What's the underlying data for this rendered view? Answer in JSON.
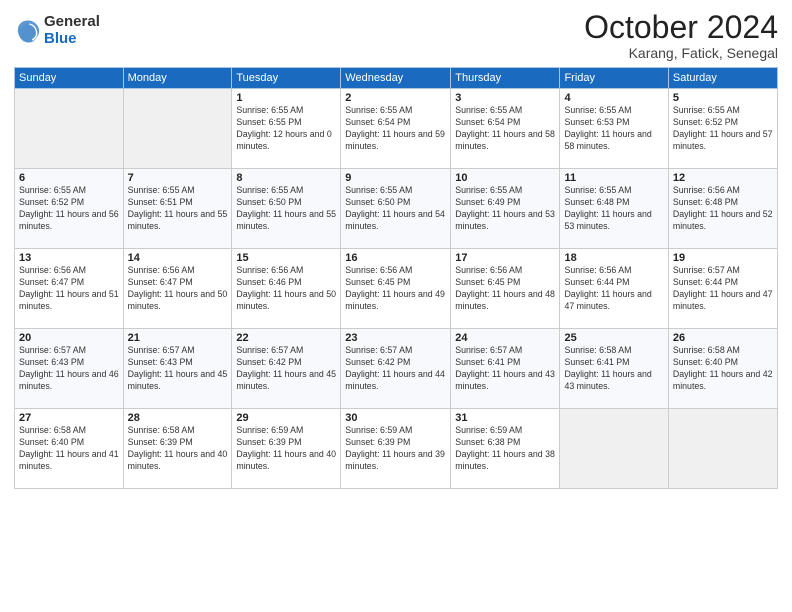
{
  "logo": {
    "general": "General",
    "blue": "Blue"
  },
  "title": "October 2024",
  "location": "Karang, Fatick, Senegal",
  "weekdays": [
    "Sunday",
    "Monday",
    "Tuesday",
    "Wednesday",
    "Thursday",
    "Friday",
    "Saturday"
  ],
  "weeks": [
    [
      {
        "day": "",
        "empty": true
      },
      {
        "day": "",
        "empty": true
      },
      {
        "day": "1",
        "sunrise": "Sunrise: 6:55 AM",
        "sunset": "Sunset: 6:55 PM",
        "daylight": "Daylight: 12 hours and 0 minutes."
      },
      {
        "day": "2",
        "sunrise": "Sunrise: 6:55 AM",
        "sunset": "Sunset: 6:54 PM",
        "daylight": "Daylight: 11 hours and 59 minutes."
      },
      {
        "day": "3",
        "sunrise": "Sunrise: 6:55 AM",
        "sunset": "Sunset: 6:54 PM",
        "daylight": "Daylight: 11 hours and 58 minutes."
      },
      {
        "day": "4",
        "sunrise": "Sunrise: 6:55 AM",
        "sunset": "Sunset: 6:53 PM",
        "daylight": "Daylight: 11 hours and 58 minutes."
      },
      {
        "day": "5",
        "sunrise": "Sunrise: 6:55 AM",
        "sunset": "Sunset: 6:52 PM",
        "daylight": "Daylight: 11 hours and 57 minutes."
      }
    ],
    [
      {
        "day": "6",
        "sunrise": "Sunrise: 6:55 AM",
        "sunset": "Sunset: 6:52 PM",
        "daylight": "Daylight: 11 hours and 56 minutes."
      },
      {
        "day": "7",
        "sunrise": "Sunrise: 6:55 AM",
        "sunset": "Sunset: 6:51 PM",
        "daylight": "Daylight: 11 hours and 55 minutes."
      },
      {
        "day": "8",
        "sunrise": "Sunrise: 6:55 AM",
        "sunset": "Sunset: 6:50 PM",
        "daylight": "Daylight: 11 hours and 55 minutes."
      },
      {
        "day": "9",
        "sunrise": "Sunrise: 6:55 AM",
        "sunset": "Sunset: 6:50 PM",
        "daylight": "Daylight: 11 hours and 54 minutes."
      },
      {
        "day": "10",
        "sunrise": "Sunrise: 6:55 AM",
        "sunset": "Sunset: 6:49 PM",
        "daylight": "Daylight: 11 hours and 53 minutes."
      },
      {
        "day": "11",
        "sunrise": "Sunrise: 6:55 AM",
        "sunset": "Sunset: 6:48 PM",
        "daylight": "Daylight: 11 hours and 53 minutes."
      },
      {
        "day": "12",
        "sunrise": "Sunrise: 6:56 AM",
        "sunset": "Sunset: 6:48 PM",
        "daylight": "Daylight: 11 hours and 52 minutes."
      }
    ],
    [
      {
        "day": "13",
        "sunrise": "Sunrise: 6:56 AM",
        "sunset": "Sunset: 6:47 PM",
        "daylight": "Daylight: 11 hours and 51 minutes."
      },
      {
        "day": "14",
        "sunrise": "Sunrise: 6:56 AM",
        "sunset": "Sunset: 6:47 PM",
        "daylight": "Daylight: 11 hours and 50 minutes."
      },
      {
        "day": "15",
        "sunrise": "Sunrise: 6:56 AM",
        "sunset": "Sunset: 6:46 PM",
        "daylight": "Daylight: 11 hours and 50 minutes."
      },
      {
        "day": "16",
        "sunrise": "Sunrise: 6:56 AM",
        "sunset": "Sunset: 6:45 PM",
        "daylight": "Daylight: 11 hours and 49 minutes."
      },
      {
        "day": "17",
        "sunrise": "Sunrise: 6:56 AM",
        "sunset": "Sunset: 6:45 PM",
        "daylight": "Daylight: 11 hours and 48 minutes."
      },
      {
        "day": "18",
        "sunrise": "Sunrise: 6:56 AM",
        "sunset": "Sunset: 6:44 PM",
        "daylight": "Daylight: 11 hours and 47 minutes."
      },
      {
        "day": "19",
        "sunrise": "Sunrise: 6:57 AM",
        "sunset": "Sunset: 6:44 PM",
        "daylight": "Daylight: 11 hours and 47 minutes."
      }
    ],
    [
      {
        "day": "20",
        "sunrise": "Sunrise: 6:57 AM",
        "sunset": "Sunset: 6:43 PM",
        "daylight": "Daylight: 11 hours and 46 minutes."
      },
      {
        "day": "21",
        "sunrise": "Sunrise: 6:57 AM",
        "sunset": "Sunset: 6:43 PM",
        "daylight": "Daylight: 11 hours and 45 minutes."
      },
      {
        "day": "22",
        "sunrise": "Sunrise: 6:57 AM",
        "sunset": "Sunset: 6:42 PM",
        "daylight": "Daylight: 11 hours and 45 minutes."
      },
      {
        "day": "23",
        "sunrise": "Sunrise: 6:57 AM",
        "sunset": "Sunset: 6:42 PM",
        "daylight": "Daylight: 11 hours and 44 minutes."
      },
      {
        "day": "24",
        "sunrise": "Sunrise: 6:57 AM",
        "sunset": "Sunset: 6:41 PM",
        "daylight": "Daylight: 11 hours and 43 minutes."
      },
      {
        "day": "25",
        "sunrise": "Sunrise: 6:58 AM",
        "sunset": "Sunset: 6:41 PM",
        "daylight": "Daylight: 11 hours and 43 minutes."
      },
      {
        "day": "26",
        "sunrise": "Sunrise: 6:58 AM",
        "sunset": "Sunset: 6:40 PM",
        "daylight": "Daylight: 11 hours and 42 minutes."
      }
    ],
    [
      {
        "day": "27",
        "sunrise": "Sunrise: 6:58 AM",
        "sunset": "Sunset: 6:40 PM",
        "daylight": "Daylight: 11 hours and 41 minutes."
      },
      {
        "day": "28",
        "sunrise": "Sunrise: 6:58 AM",
        "sunset": "Sunset: 6:39 PM",
        "daylight": "Daylight: 11 hours and 40 minutes."
      },
      {
        "day": "29",
        "sunrise": "Sunrise: 6:59 AM",
        "sunset": "Sunset: 6:39 PM",
        "daylight": "Daylight: 11 hours and 40 minutes."
      },
      {
        "day": "30",
        "sunrise": "Sunrise: 6:59 AM",
        "sunset": "Sunset: 6:39 PM",
        "daylight": "Daylight: 11 hours and 39 minutes."
      },
      {
        "day": "31",
        "sunrise": "Sunrise: 6:59 AM",
        "sunset": "Sunset: 6:38 PM",
        "daylight": "Daylight: 11 hours and 38 minutes."
      },
      {
        "day": "",
        "empty": true
      },
      {
        "day": "",
        "empty": true
      }
    ]
  ]
}
